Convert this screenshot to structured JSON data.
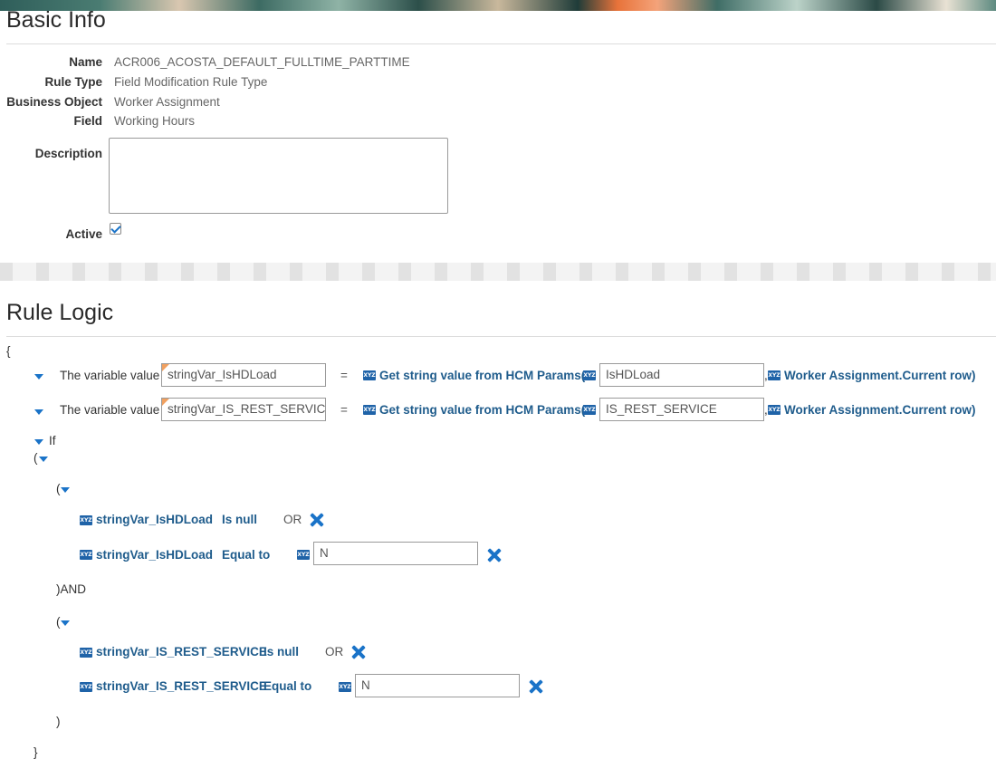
{
  "basic_info": {
    "title": "Basic Info",
    "fields": [
      {
        "label": "Name",
        "value": "ACR006_ACOSTA_DEFAULT_FULLTIME_PARTTIME"
      },
      {
        "label": "Rule Type",
        "value": "Field Modification Rule Type"
      },
      {
        "label": "Business Object",
        "value": "Worker Assignment"
      },
      {
        "label": "Field",
        "value": "Working Hours"
      }
    ],
    "description_label": "Description",
    "description_value": "",
    "active_label": "Active",
    "active_checked": true
  },
  "rule_logic": {
    "title": "Rule Logic",
    "open_brace": "{",
    "close_brace": "}",
    "assignments": [
      {
        "prefix": "The variable value",
        "variable": "stringVar_IsHDLoad",
        "operator": "=",
        "function": "Get string value from HCM Params(",
        "param": "IsHDLoad",
        "comma": ",",
        "object": "Worker Assignment.Current row)"
      },
      {
        "prefix": "The variable value",
        "variable": "stringVar_IS_REST_SERVICE",
        "operator": "=",
        "function": "Get string value from HCM Params(",
        "param": "IS_REST_SERVICE",
        "comma": ",",
        "object": "Worker Assignment.Current row)"
      }
    ],
    "if_label": "If",
    "open_paren": "(",
    "close_paren": ")",
    "and_label": ")AND",
    "group1": {
      "row1": {
        "variable": "stringVar_IsHDLoad",
        "condition": "Is null",
        "logic": "OR"
      },
      "row2": {
        "variable": "stringVar_IsHDLoad",
        "condition": "Equal to",
        "value": "N"
      }
    },
    "group2": {
      "row1": {
        "variable": "stringVar_IS_REST_SERVICE",
        "condition": "Is null",
        "logic": "OR"
      },
      "row2": {
        "variable": "stringVar_IS_REST_SERVICE",
        "condition": "Equal to",
        "value": "N"
      }
    },
    "xyz_icon_text": "XYZ"
  },
  "colors": {
    "accent": "#1a73c8",
    "link": "#1f5c8c"
  }
}
